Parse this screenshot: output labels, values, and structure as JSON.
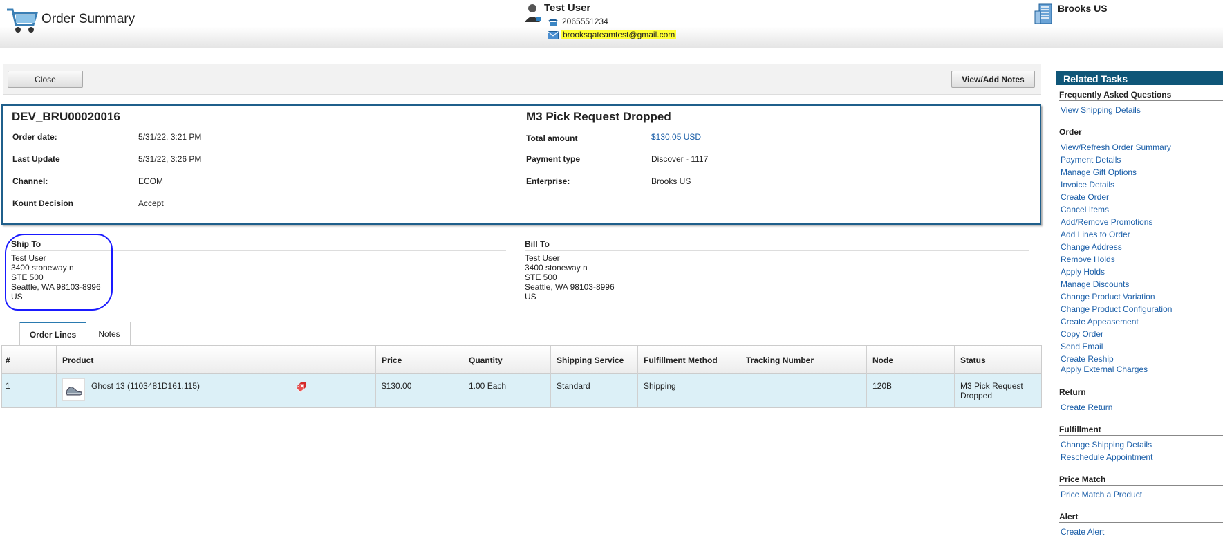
{
  "header": {
    "title": "Order Summary",
    "customer_name": "Test User",
    "customer_phone": "2065551234",
    "customer_email": "brooksqateamtest@gmail.com",
    "enterprise": "Brooks US"
  },
  "toolbar": {
    "close_label": "Close",
    "notes_label": "View/Add Notes"
  },
  "order": {
    "number": "DEV_BRU00020016",
    "status": "M3 Pick Request Dropped",
    "left_fields": [
      {
        "label": "Order date:",
        "value": "5/31/22, 3:21 PM"
      },
      {
        "label": "Last Update",
        "value": "5/31/22, 3:26 PM"
      },
      {
        "label": "Channel:",
        "value": "ECOM"
      },
      {
        "label": "Kount Decision",
        "value": "Accept"
      }
    ],
    "right_fields": [
      {
        "label": "Total amount",
        "value": "$130.05 USD"
      },
      {
        "label": "Payment type",
        "value": "Discover - 1117"
      },
      {
        "label": "Enterprise:",
        "value": "Brooks US"
      }
    ]
  },
  "ship_to": {
    "heading": "Ship To",
    "lines": [
      "Test User",
      "3400 stoneway n",
      "STE 500",
      "Seattle, WA 98103-8996",
      "US"
    ]
  },
  "bill_to": {
    "heading": "Bill To",
    "lines": [
      "Test User",
      "3400 stoneway n",
      "STE 500",
      "Seattle, WA 98103-8996",
      "US"
    ]
  },
  "tabs": [
    "Order Lines",
    "Notes"
  ],
  "table": {
    "headers": [
      "#",
      "Product",
      "Price",
      "Quantity",
      "Shipping Service",
      "Fulfillment Method",
      "Tracking Number",
      "Node",
      "Status"
    ],
    "rows": [
      {
        "num": "1",
        "product": "Ghost 13 (1103481D161.115)",
        "price": "$130.00",
        "quantity": "1.00 Each",
        "shipping_service": "Standard",
        "fulfillment": "Shipping",
        "tracking": "",
        "node": "120B",
        "status_line1": "M3 Pick Request",
        "status_line2": "Dropped"
      }
    ]
  },
  "related_tasks": {
    "title": "Related Tasks",
    "faq_heading": "Frequently Asked Questions",
    "faq_links": [
      "View Shipping Details"
    ],
    "order_heading": "Order",
    "order_links": [
      "View/Refresh Order Summary",
      "Payment Details",
      "Manage Gift Options",
      "Invoice Details",
      "Create Order",
      "Cancel Items",
      "Add/Remove Promotions",
      "Add Lines to Order",
      "Change Address",
      "Remove Holds",
      "Apply Holds",
      "Manage Discounts",
      "Change Product Variation",
      "Change Product Configuration",
      "Create Appeasement",
      "Copy Order",
      "Send Email",
      "Create Reship",
      "Apply External Charges"
    ],
    "return_heading": "Return",
    "return_links": [
      "Create Return"
    ],
    "fulfillment_heading": "Fulfillment",
    "fulfillment_links": [
      "Change Shipping Details",
      "Reschedule Appointment"
    ],
    "pricematch_heading": "Price Match",
    "pricematch_links": [
      "Price Match a Product"
    ],
    "alert_heading": "Alert",
    "alert_links": [
      "Create Alert"
    ]
  },
  "colors": {
    "accent": "#0f5678",
    "link": "#1a5ea8",
    "row_highlight": "#dcf0f7",
    "email_highlight": "#ffff33",
    "annotation": "#1a1aff"
  }
}
